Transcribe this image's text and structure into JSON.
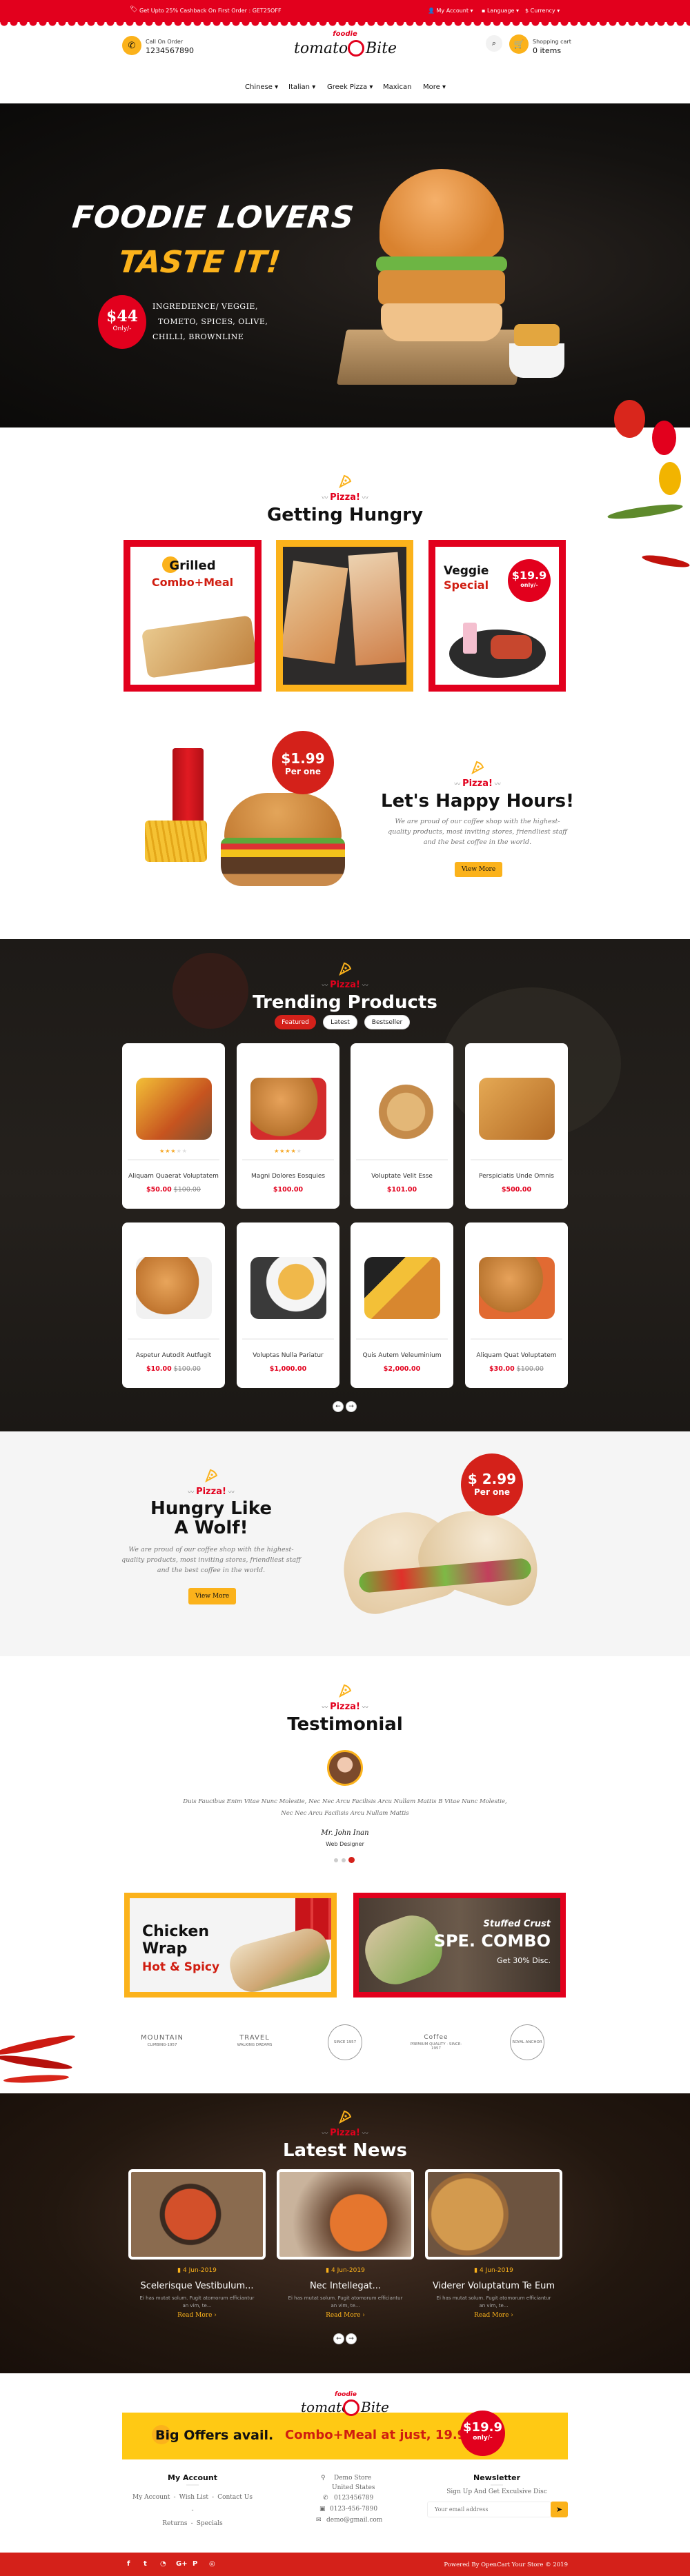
{
  "topbar": {
    "promo": "Get Upto 25% Cashback On First Order : GET25OFF",
    "account": "My Account",
    "language": "Language",
    "currency": "$ Currency"
  },
  "header": {
    "call_label": "Call On Order",
    "phone": "1234567890",
    "logo_small": "foodie",
    "logo_main_left": "tomato",
    "logo_main_right": "Bite",
    "cart_label": "Shopping cart",
    "cart_count": "0 items"
  },
  "nav": [
    {
      "label": "Chinese",
      "dropdown": true
    },
    {
      "label": "Italian",
      "dropdown": true
    },
    {
      "label": "Greek Pizza",
      "dropdown": true
    },
    {
      "label": "Maxican",
      "dropdown": false
    },
    {
      "label": "More",
      "dropdown": true
    }
  ],
  "hero": {
    "line1": "FOODIE LOVERS",
    "line2": "TASTE IT!",
    "price": "$44",
    "price_note": "Only/-",
    "ingredients": [
      "INGREDIENCE/ VEGGIE,",
      "TOMETO, SPICES, OLIVE,",
      "CHILLI, BROWNLINE"
    ]
  },
  "section_tag": "Pizza!",
  "hungry": {
    "title": "Getting Hungry",
    "card1": {
      "word1": "Grilled",
      "word2": "Combo+Meal"
    },
    "card3": {
      "word1": "Veggie",
      "word2": "Special",
      "price": "$19.9",
      "note": "only/-"
    }
  },
  "happy": {
    "title": "Let's Happy Hours!",
    "text": "We are proud of our coffee shop with the highest-quality products, most inviting stores, friendliest staff and the best coffee in the world.",
    "button": "View More",
    "price": "$1.99",
    "note": "Per one"
  },
  "trending": {
    "title": "Trending Products",
    "tabs": [
      "Featured",
      "Latest",
      "Bestseller"
    ],
    "active_tab": "Featured",
    "products": [
      {
        "name": "Aliquam Quaerat Voluptatem",
        "price": "$50.00",
        "old": "$100.00",
        "rating": 3
      },
      {
        "name": "Magni Dolores Eosquies",
        "price": "$100.00",
        "old": "",
        "rating": 4
      },
      {
        "name": "Voluptate Velit Esse",
        "price": "$101.00",
        "old": "",
        "rating": null
      },
      {
        "name": "Perspiciatis Unde Omnis",
        "price": "$500.00",
        "old": "",
        "rating": null
      },
      {
        "name": "Aspetur Autodit Autfugit",
        "price": "$10.00",
        "old": "$100.00",
        "rating": null
      },
      {
        "name": "Voluptas Nulla Pariatur",
        "price": "$1,000.00",
        "old": "",
        "rating": null
      },
      {
        "name": "Quis Autem Veleuminium",
        "price": "$2,000.00",
        "old": "",
        "rating": null
      },
      {
        "name": "Aliquam Quat Voluptatem",
        "price": "$30.00",
        "old": "$100.00",
        "rating": null
      }
    ]
  },
  "wolf": {
    "title1": "Hungry Like",
    "title2": "A Wolf!",
    "text": "We are proud of our coffee shop with the highest-quality products, most inviting stores, friendliest staff and the best coffee in the world.",
    "button": "View More",
    "price": "$ 2.99",
    "note": "Per one"
  },
  "testimonial": {
    "title": "Testimonial",
    "quote": "Duis Faucibus Enim Vitae Nunc Molestie, Nec Nec Arcu Facilisis Arcu Nullam Mattis B Vitae Nunc Molestie, Nec Nec Arcu Facilisis Arcu Nullam Mattis",
    "name": "Mr. John Inan",
    "role": "Web Designer",
    "slides": 3,
    "active_slide": 3
  },
  "banners": {
    "left": {
      "l1": "Chicken",
      "l2": "Wrap",
      "l3": "Hot & Spicy"
    },
    "right": {
      "l1": "Stuffed Crust",
      "l2": "SPE. COMBO",
      "l3": "Get 30% Disc."
    }
  },
  "brands": [
    {
      "name": "MOUNTAIN",
      "sub": "CLIMBING-1957"
    },
    {
      "name": "TRAVEL",
      "sub": "WALKING DREAMS"
    },
    {
      "name": "",
      "sub": "SINCE 1957"
    },
    {
      "name": "Coffee",
      "sub": "PREMIUM QUALITY · SINCE-1957"
    },
    {
      "name": "",
      "sub": "ROYAL ANCHOR"
    }
  ],
  "news": {
    "title": "Latest News",
    "items": [
      {
        "date": "4 Jun-2019",
        "title": "Scelerisque Vestibulum...",
        "text": "Ei has mutat solum. Fugit atomorum efficiantur an vim, te...",
        "link": "Read More"
      },
      {
        "date": "4 Jun-2019",
        "title": "Nec Intellegat...",
        "text": "Ei has mutat solum. Fugit atomorum efficiantur an vim, te...",
        "link": "Read More"
      },
      {
        "date": "4 Jun-2019",
        "title": "Viderer Voluptatum Te Eum",
        "text": "Ei has mutat solum. Fugit atomorum efficiantur an vim, te...",
        "link": "Read More"
      }
    ]
  },
  "offer": {
    "text1": "Big Offers avail.",
    "text2": "Combo+Meal at just, 19.9/-",
    "price": "$19.9",
    "note": "only/-"
  },
  "footer": {
    "account_title": "My Account",
    "account_links": [
      "My Account",
      "Wish List",
      "Contact Us",
      "Returns",
      "Specials"
    ],
    "store": "Demo Store",
    "country": "United States",
    "phone": "0123456789",
    "fax": "0123-456-7890",
    "email": "demo@gmail.com",
    "newsletter_title": "Newsletter",
    "newsletter_sub": "Sign Up And Get Exculsive Disc",
    "email_placeholder": "Your email address",
    "social": [
      "facebook",
      "twitter",
      "rss",
      "google-plus",
      "pinterest",
      "instagram"
    ],
    "powered": "Powered By OpenCart Your Store © 2019"
  },
  "colors": {
    "red": "#e2001d",
    "yellow": "#fbb21b",
    "dark": "#1d1a17"
  }
}
